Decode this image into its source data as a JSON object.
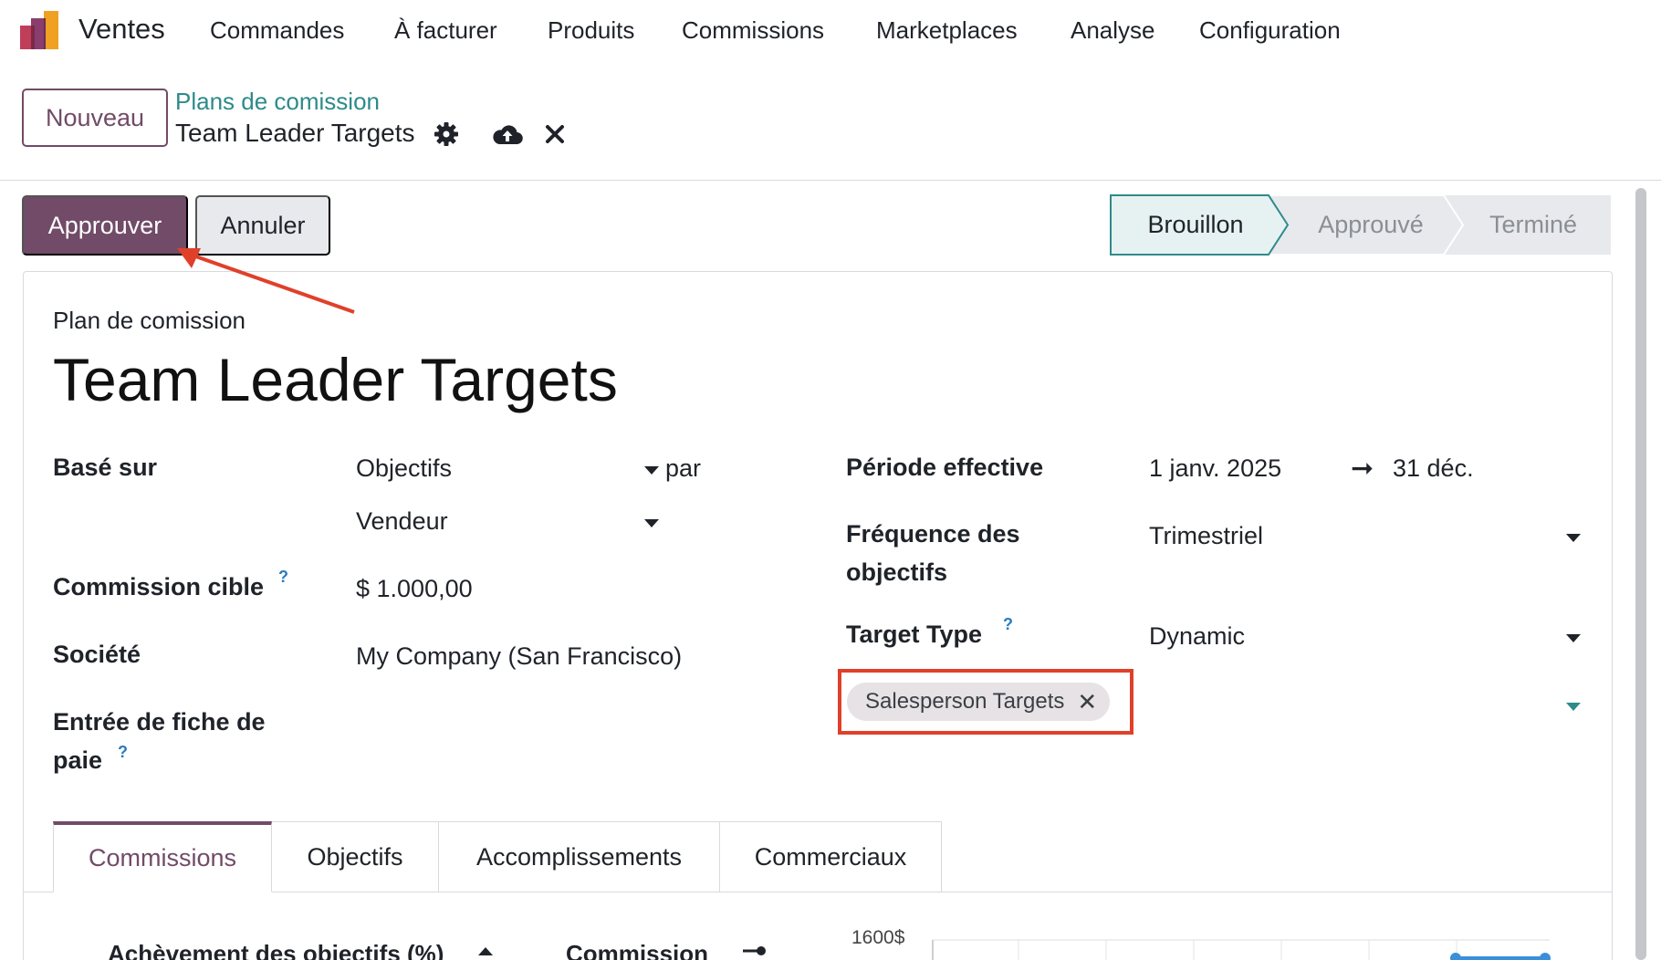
{
  "app": {
    "name": "Ventes"
  },
  "menu": [
    "Commandes",
    "À facturer",
    "Produits",
    "Commissions",
    "Marketplaces",
    "Analyse",
    "Configuration"
  ],
  "control_panel": {
    "new_label": "Nouveau",
    "breadcrumb_parent": "Plans de comission",
    "breadcrumb_current": "Team Leader Targets"
  },
  "actions": {
    "approve_label": "Approuver",
    "cancel_label": "Annuler"
  },
  "status": {
    "stages": [
      "Brouillon",
      "Approuvé",
      "Terminé"
    ],
    "current": "Brouillon"
  },
  "form": {
    "subtitle": "Plan de comission",
    "name": "Team Leader Targets",
    "left": {
      "based_on_label": "Basé sur",
      "based_on_value": "Objectifs",
      "per_label": "par",
      "per_value": "Vendeur",
      "target_commission_label": "Commission cible",
      "target_commission_help": "?",
      "target_commission_value": "$ 1.000,00",
      "company_label": "Société",
      "company_value": "My Company (San Francisco)",
      "payslip_label_line1": "Entrée de fiche de",
      "payslip_label_line2": "paie",
      "payslip_help": "?"
    },
    "right": {
      "period_label": "Période effective",
      "period_start": "1 janv. 2025",
      "period_arrow": "➞",
      "period_end": "31 déc.",
      "frequency_label_line1": "Fréquence des",
      "frequency_label_line2": "objectifs",
      "frequency_value": "Trimestriel",
      "target_type_label": "Target Type",
      "target_type_help": "?",
      "target_type_value": "Dynamic",
      "tag_label": "Salesperson Targets",
      "tag_remove": "✕"
    }
  },
  "tabs": [
    {
      "label": "Commissions",
      "active": true
    },
    {
      "label": "Objectifs",
      "active": false
    },
    {
      "label": "Accomplissements",
      "active": false
    },
    {
      "label": "Commerciaux",
      "active": false
    }
  ],
  "table": {
    "col1": "Achèvement des objectifs (%)",
    "col2": "Commission"
  },
  "chart": {
    "top_tick": "1600$"
  },
  "colors": {
    "brand": "#714b67",
    "link": "#2f8a8a",
    "annotation": "#e0402a",
    "help": "#2a7bbd"
  }
}
